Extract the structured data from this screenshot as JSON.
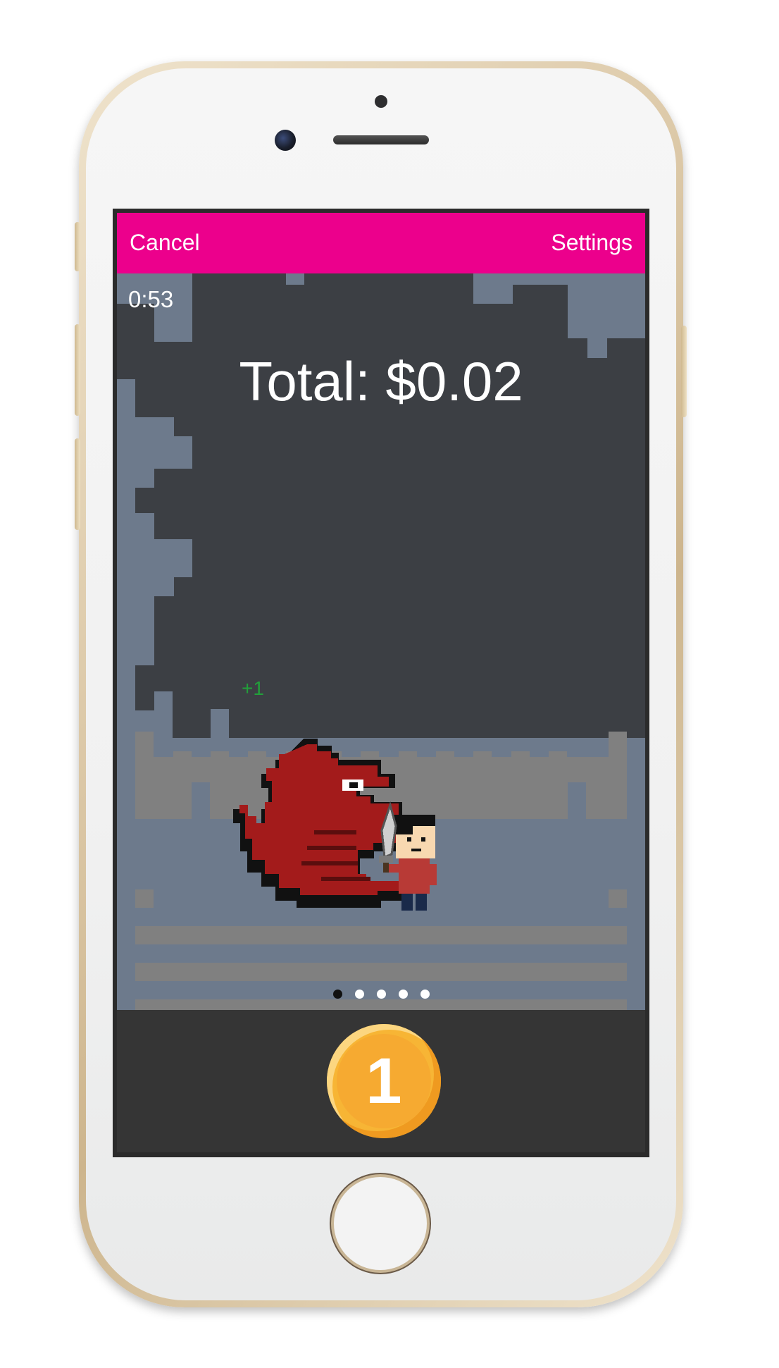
{
  "app": {
    "nav": {
      "cancel_label": "Cancel",
      "settings_label": "Settings"
    },
    "game": {
      "timer": "0:53",
      "total": "Total: $0.02",
      "score_popup": "+1",
      "page_dots": {
        "count": 5,
        "active_index": 0
      }
    },
    "coin_button": {
      "label": "1"
    }
  },
  "colors": {
    "nav_bar": "#ec008c",
    "game_background": "#3c3f44",
    "castle_stone": "#6d7a8c",
    "coin": "#f6aa31",
    "score_popup": "#22a03a",
    "dragon": "#a31b1b"
  },
  "icons": [
    "dragon-sprite",
    "hero-sprite",
    "sword-icon",
    "coin-icon"
  ]
}
